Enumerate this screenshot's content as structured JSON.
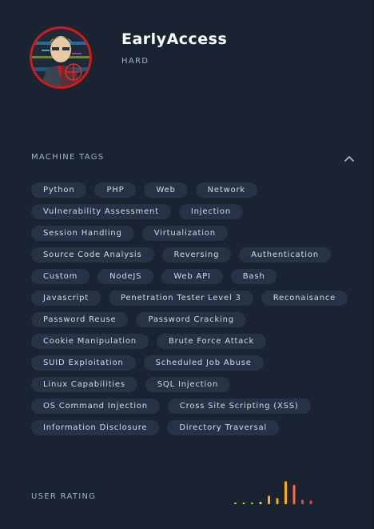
{
  "machine": {
    "name": "EarlyAccess",
    "difficulty": "HARD"
  },
  "tags_section": {
    "title": "MACHINE TAGS",
    "collapse_icon": "chevron-up-icon",
    "rows": [
      [
        "Python",
        "PHP",
        "Web",
        "Network"
      ],
      [
        "Vulnerability Assessment",
        "Injection"
      ],
      [
        "Session Handling",
        "Virtualization"
      ],
      [
        "Source Code Analysis",
        "Reversing",
        "Authentication"
      ],
      [
        "Custom",
        "NodeJS",
        "Web API",
        "Bash"
      ],
      [
        "Javascript",
        "Penetration Tester Level 3",
        "Reconaisance"
      ],
      [
        "Password Reuse",
        "Password Cracking"
      ],
      [
        "Cookie Manipulation",
        "Brute Force Attack"
      ],
      [
        "SUID Exploitation",
        "Scheduled Job Abuse"
      ],
      [
        "Linux Capabilities",
        "SQL Injection"
      ],
      [
        "OS Command Injection",
        "Cross Site Scripting (XSS)"
      ],
      [
        "Information Disclosure",
        "Directory Traversal"
      ]
    ]
  },
  "user_rating": {
    "label": "USER RATING",
    "levels": [
      0.05,
      0.05,
      0.05,
      0.1,
      0.35,
      0.25,
      0.95,
      0.8,
      0.18,
      0.15
    ],
    "colors": [
      "#9fef00",
      "#9fef00",
      "#9fef00",
      "#c6e014",
      "#ffaf00",
      "#ffaf00",
      "#ffaf00",
      "#ff6a3d",
      "#ff3e3e",
      "#ff3e3e"
    ]
  }
}
